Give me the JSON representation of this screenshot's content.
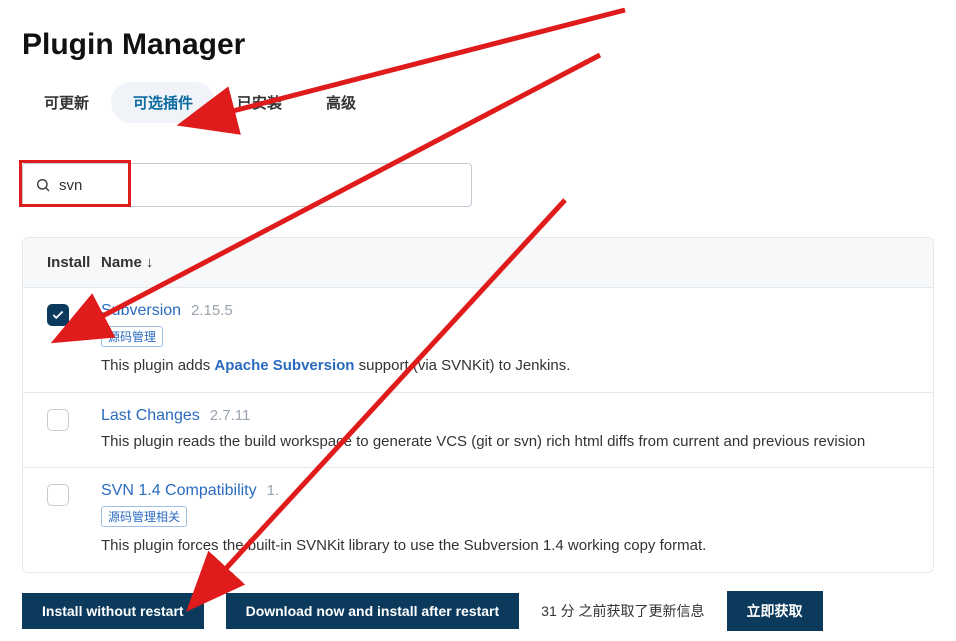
{
  "pageTitle": "Plugin Manager",
  "tabs": [
    {
      "label": "可更新",
      "active": false
    },
    {
      "label": "可选插件",
      "active": true
    },
    {
      "label": "已安装",
      "active": false
    },
    {
      "label": "高级",
      "active": false
    }
  ],
  "search": {
    "value": "svn"
  },
  "columns": {
    "install": "Install",
    "name": "Name"
  },
  "sortIndicator": "↓",
  "plugins": [
    {
      "name": "Subversion",
      "version": "2.15.5",
      "tag": "源码管理",
      "checked": true,
      "descPrefix": "This plugin adds ",
      "descLink": "Apache Subversion",
      "descSuffix": " support (via SVNKit) to Jenkins."
    },
    {
      "name": "Last Changes",
      "version": "2.7.11",
      "tag": "",
      "checked": false,
      "descPrefix": "This plugin reads the build workspace to generate VCS (git or svn) rich html diffs from current and previous revision",
      "descLink": "",
      "descSuffix": ""
    },
    {
      "name": "SVN 1.4 Compatibility",
      "version": "1.",
      "tag": "源码管理相关",
      "checked": false,
      "descPrefix": "This plugin forces the built-in SVNKit library to use the Subversion 1.4 working copy format.",
      "descLink": "",
      "descSuffix": ""
    }
  ],
  "buttons": {
    "installNoRestart": "Install without restart",
    "downloadInstall": "Download now and install after restart",
    "fetchNow": "立即获取"
  },
  "updateInfo": "31 分 之前获取了更新信息",
  "colors": {
    "annotation": "#e01b1b",
    "primary": "#0b3a5d",
    "link": "#2a6bbf"
  }
}
